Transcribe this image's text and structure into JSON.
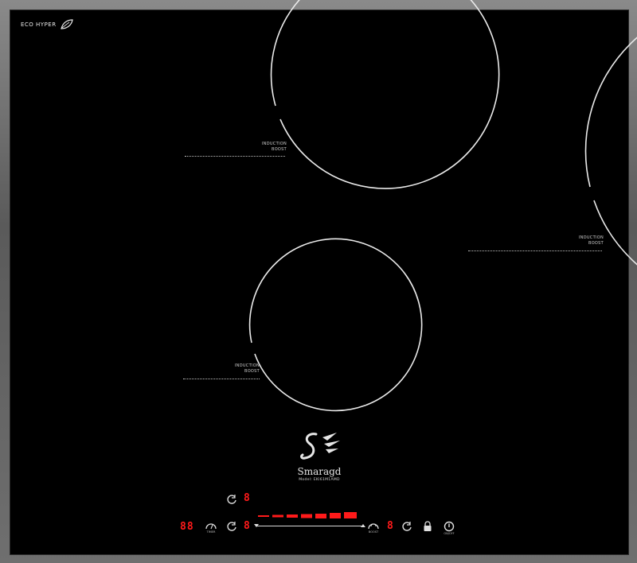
{
  "brand": {
    "text": "ECO HYPER",
    "icon": "leaf-icon"
  },
  "zones": [
    {
      "label_line1": "INDUCTION",
      "label_line2": "BOOST"
    },
    {
      "label_line1": "INDUCTION",
      "label_line2": "BOOST"
    },
    {
      "label_line1": "INDUCTION",
      "label_line2": "BOOST"
    }
  ],
  "logo": {
    "name": "Smaragd",
    "model": "Model: EKI61M1AMD"
  },
  "controls": {
    "timer_display": "88",
    "zone_top_display": "8",
    "zone_left_display": "8",
    "zone_right_display": "8",
    "timer_sub": "TIMER",
    "boost_sub": "BOOST",
    "lock_icon": "lock-icon",
    "power_icon": "power-icon",
    "power_sub": "ON/OFF",
    "level_bars": 7,
    "accent": "#ff1a1a"
  }
}
